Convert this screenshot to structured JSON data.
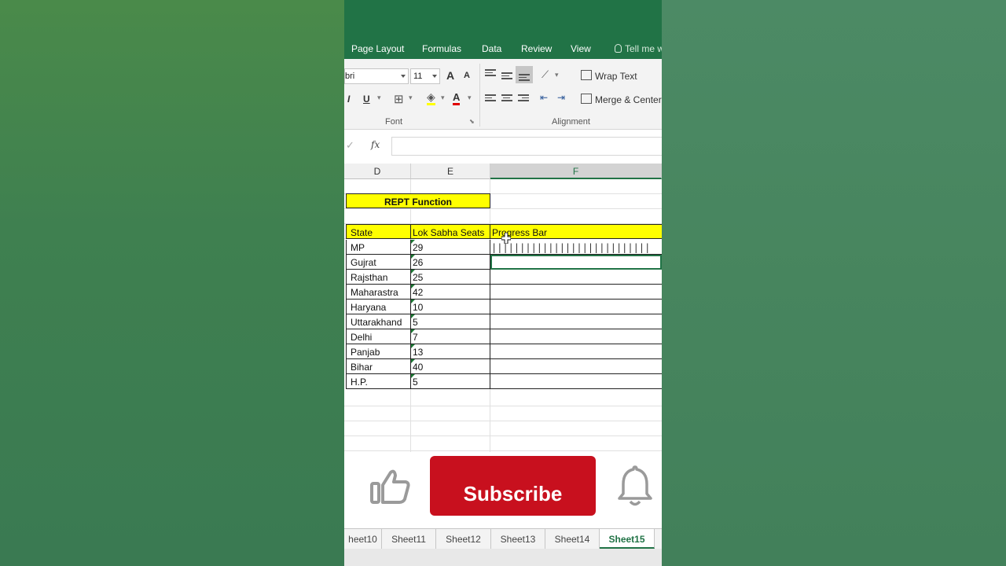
{
  "ribbon": {
    "tabs": [
      "Page Layout",
      "Formulas",
      "Data",
      "Review",
      "View"
    ],
    "tell_me": "Tell me w",
    "font_name": "bri",
    "font_size": "11",
    "bold_partial": "I",
    "underline": "U",
    "wrap_text": "Wrap Text",
    "merge_center": "Merge & Center",
    "font_group": "Font",
    "alignment_group": "Alignment",
    "grow_font": "A",
    "shrink_font": "A",
    "font_color": "A",
    "fx": "fx"
  },
  "columns": [
    "D",
    "E",
    "F"
  ],
  "sheet": {
    "title": "REPT Function",
    "headers": [
      "State",
      "Lok Sabha Seats",
      "Progress Bar"
    ],
    "rows": [
      {
        "state": "MP",
        "seats": "29"
      },
      {
        "state": "Gujrat",
        "seats": "26"
      },
      {
        "state": "Rajsthan",
        "seats": "25"
      },
      {
        "state": "Maharastra",
        "seats": "42"
      },
      {
        "state": "Haryana",
        "seats": "10"
      },
      {
        "state": "Uttarakhand",
        "seats": "5"
      },
      {
        "state": "Delhi",
        "seats": "7"
      },
      {
        "state": "Panjab",
        "seats": "13"
      },
      {
        "state": "Bihar",
        "seats": "40"
      },
      {
        "state": "H.P.",
        "seats": "5"
      }
    ],
    "mp_progress_bar": "||||||||||||||||||||||||||||"
  },
  "overlay": {
    "subscribe": "Subscribe"
  },
  "sheet_tabs": [
    "heet10",
    "Sheet11",
    "Sheet12",
    "Sheet13",
    "Sheet14",
    "Sheet15"
  ],
  "colors": {
    "excel_green": "#217346",
    "subscribe_red": "#c8101e",
    "highlight_yellow": "#ffff00"
  }
}
